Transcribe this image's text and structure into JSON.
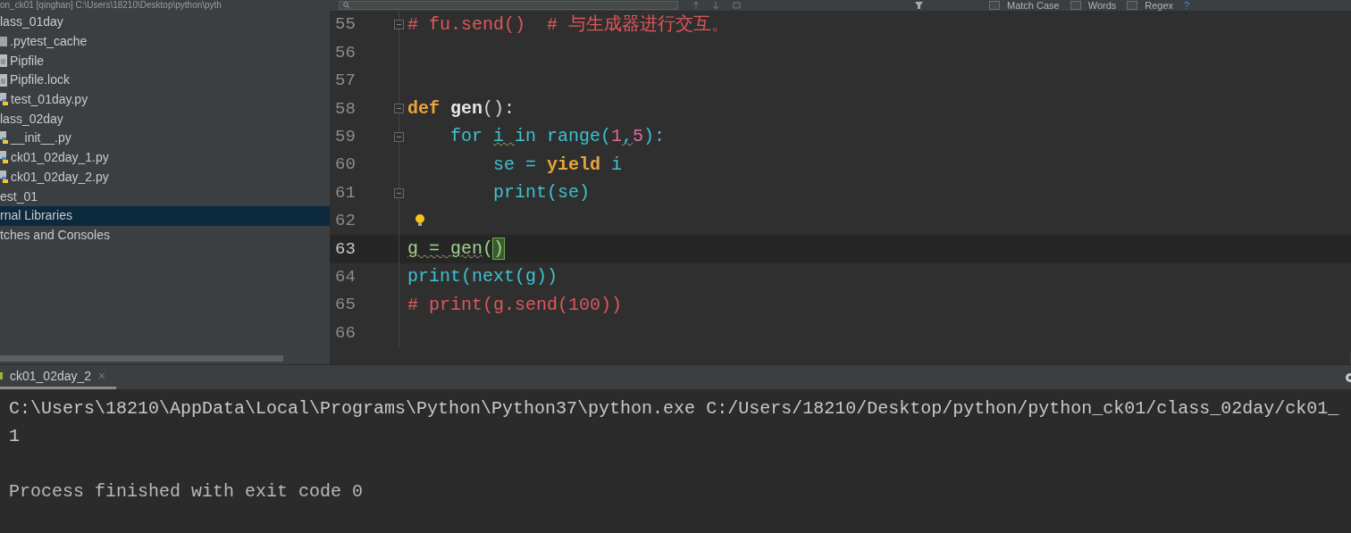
{
  "project_title": "on_ck01 [qinghan]  C:\\Users\\18210\\Desktop\\python\\pyth",
  "find_bar": {
    "options": [
      {
        "label": "Match Case",
        "checked": false
      },
      {
        "label": "Words",
        "checked": false
      },
      {
        "label": "Regex",
        "checked": false
      }
    ],
    "help": "?"
  },
  "project_tree": [
    {
      "label": "lass_01day",
      "kind": "folder",
      "selected": false
    },
    {
      "label": ".pytest_cache",
      "kind": "cache",
      "selected": false
    },
    {
      "label": "Pipfile",
      "kind": "text",
      "selected": false
    },
    {
      "label": "Pipfile.lock",
      "kind": "text",
      "selected": false
    },
    {
      "label": "test_01day.py",
      "kind": "python",
      "selected": false
    },
    {
      "label": "lass_02day",
      "kind": "folder",
      "selected": false
    },
    {
      "label": "__init__.py",
      "kind": "python",
      "selected": false
    },
    {
      "label": "ck01_02day_1.py",
      "kind": "python",
      "selected": false
    },
    {
      "label": "ck01_02day_2.py",
      "kind": "python",
      "selected": false
    },
    {
      "label": "est_01",
      "kind": "folder",
      "selected": false
    },
    {
      "label": "rnal Libraries",
      "kind": "folder",
      "selected": true
    },
    {
      "label": "tches and Consoles",
      "kind": "folder",
      "selected": false
    }
  ],
  "editor": {
    "lines": [
      {
        "number": "55",
        "current": false,
        "fold": true,
        "bulb": false,
        "tokens": [
          {
            "text": "# fu.send()  # 与生成器进行交互。",
            "kind": "comment"
          }
        ]
      },
      {
        "number": "56",
        "current": false,
        "fold": false,
        "bulb": false
      },
      {
        "number": "57",
        "current": false,
        "fold": false,
        "bulb": false
      },
      {
        "number": "58",
        "current": false,
        "fold": true,
        "bulb": false,
        "tokens": [
          {
            "text": "def ",
            "kind": "keyword"
          },
          {
            "text": "gen",
            "kind": "function"
          },
          {
            "text": "():",
            "kind": "plain"
          }
        ]
      },
      {
        "number": "59",
        "current": false,
        "fold": true,
        "bulb": false,
        "tokens": [
          {
            "text": "    for ",
            "kind": "builtin"
          },
          {
            "text": "i ",
            "kind": "builtin",
            "warning": true
          },
          {
            "text": "in ",
            "kind": "builtin"
          },
          {
            "text": "range(",
            "kind": "builtin"
          },
          {
            "text": "1",
            "kind": "number"
          },
          {
            "text": ",",
            "kind": "builtin",
            "warning": true
          },
          {
            "text": "5",
            "kind": "number"
          },
          {
            "text": "):",
            "kind": "builtin"
          }
        ]
      },
      {
        "number": "60",
        "current": false,
        "fold": false,
        "bulb": false,
        "tokens": [
          {
            "text": "        se = ",
            "kind": "builtin"
          },
          {
            "text": "yield ",
            "kind": "keyword"
          },
          {
            "text": "i",
            "kind": "builtin"
          }
        ]
      },
      {
        "number": "61",
        "current": false,
        "fold": true,
        "bulb": false,
        "tokens": [
          {
            "text": "        print(se)",
            "kind": "builtin"
          }
        ]
      },
      {
        "number": "62",
        "current": false,
        "fold": false,
        "bulb": true
      },
      {
        "number": "63",
        "current": true,
        "fold": false,
        "bulb": false,
        "tokens": [
          {
            "text": "g = gen",
            "kind": "variable",
            "warning": true
          },
          {
            "text": "(",
            "kind": "variable"
          },
          {
            "text": ")",
            "kind": "variable",
            "matched": true
          }
        ]
      },
      {
        "number": "64",
        "current": false,
        "fold": false,
        "bulb": false,
        "tokens": [
          {
            "text": "print(next(g))",
            "kind": "builtin"
          }
        ]
      },
      {
        "number": "65",
        "current": false,
        "fold": false,
        "bulb": false,
        "tokens": [
          {
            "text": "# print(g.send(100))",
            "kind": "comment"
          }
        ]
      },
      {
        "number": "66",
        "current": false,
        "fold": false,
        "bulb": false
      }
    ]
  },
  "run_tabs": [
    {
      "label": "ck01_02day_2",
      "selected": true,
      "close": "×"
    }
  ],
  "console": [
    {
      "text": "C:\\Users\\18210\\AppData\\Local\\Programs\\Python\\Python37\\python.exe C:/Users/18210/Desktop/python/python_ck01/class_02day/ck01_",
      "kind": "command"
    },
    {
      "text": "1",
      "kind": "output"
    },
    {
      "text": "Process finished with exit code 0",
      "kind": "status"
    }
  ]
}
